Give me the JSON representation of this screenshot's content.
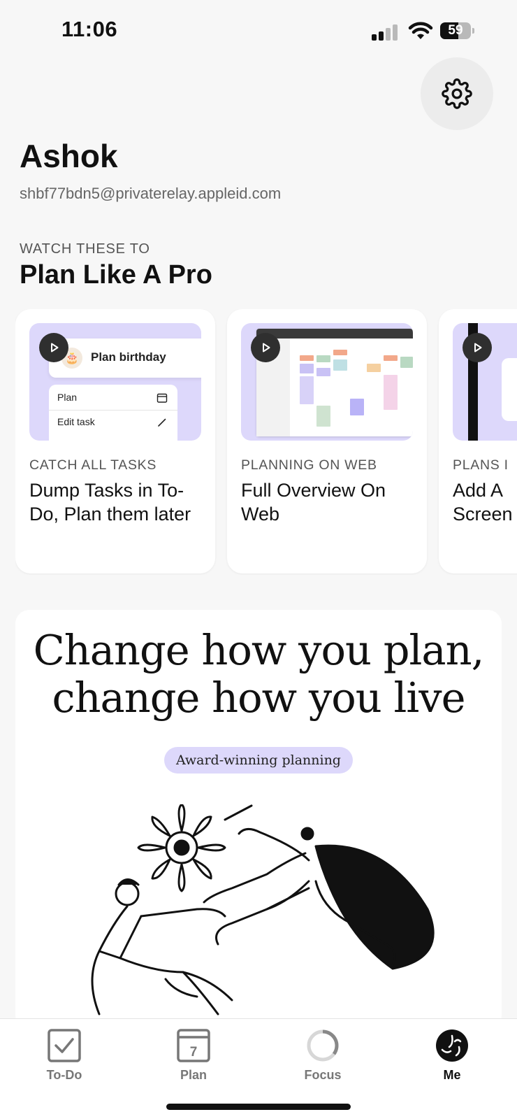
{
  "status_bar": {
    "time": "11:06",
    "battery_level": "59",
    "battery_percent": 59
  },
  "settings": {
    "icon": "gear-icon"
  },
  "profile": {
    "name": "Ashok",
    "email": "shbf77bdn5@privaterelay.appleid.com"
  },
  "tutorials": {
    "eyebrow": "WATCH THESE TO",
    "title": "Plan Like A Pro",
    "cards": [
      {
        "category": "CATCH ALL TASKS",
        "title": "Dump Tasks in To-Do, Plan them later",
        "thumb_task": "Plan birthday",
        "thumb_menu": [
          "Plan",
          "Edit task"
        ]
      },
      {
        "category": "PLANNING ON WEB",
        "title": "Full Overview On Web"
      },
      {
        "category": "PLANS I",
        "title": "Add A Screen"
      }
    ]
  },
  "promo": {
    "headline_line1": "Change how you plan,",
    "headline_line2": "change how you live",
    "pill": "Award-winning planning"
  },
  "tab_bar": {
    "tabs": [
      {
        "label": "To-Do",
        "icon": "checkbox-icon",
        "active": false
      },
      {
        "label": "Plan",
        "icon": "calendar-icon",
        "calendar_day": "7",
        "active": false
      },
      {
        "label": "Focus",
        "icon": "focus-ring-icon",
        "active": false
      },
      {
        "label": "Me",
        "icon": "profile-face-icon",
        "active": true
      }
    ]
  },
  "colors": {
    "background": "#f7f7f7",
    "card": "#ffffff",
    "accent_lavender": "#ddd8fb",
    "text_primary": "#111111",
    "text_secondary": "#666666"
  }
}
